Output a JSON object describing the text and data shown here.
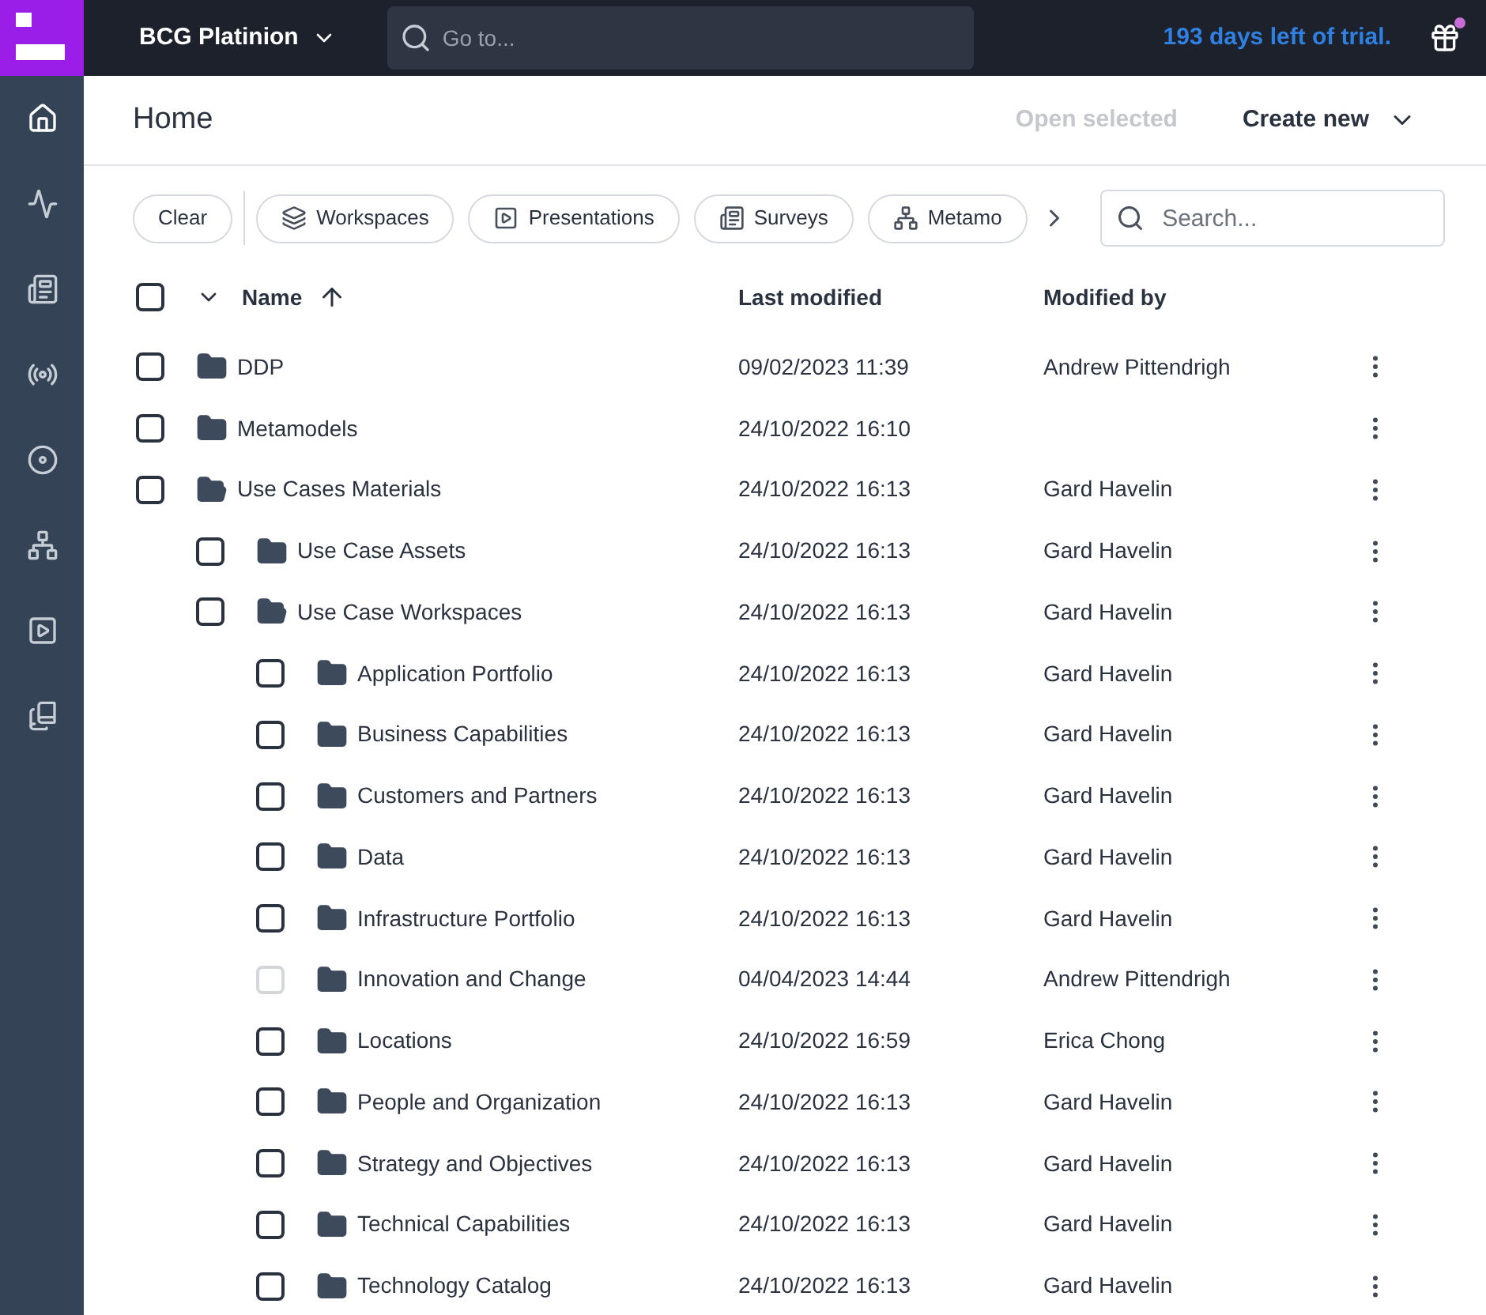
{
  "topbar": {
    "org": "BCG Platinion",
    "search_placeholder": "Go to...",
    "trial": "193 days left of trial.",
    "gift_notification": true
  },
  "sidebar": {
    "items": [
      {
        "selected": true
      },
      {
        "selected": false
      },
      {
        "selected": false
      },
      {
        "selected": false
      },
      {
        "selected": false
      },
      {
        "selected": false
      },
      {
        "selected": false
      },
      {
        "selected": false
      }
    ]
  },
  "header": {
    "title": "Home",
    "open_selected": {
      "label": "Open selected",
      "disabled": true
    },
    "create_new": "Create new"
  },
  "filters": {
    "clear": "Clear",
    "chips": [
      {
        "label": "Workspaces"
      },
      {
        "label": "Presentations"
      },
      {
        "label": "Surveys"
      },
      {
        "label": "Metamo"
      }
    ],
    "search_placeholder": "Search..."
  },
  "table": {
    "select_all": {
      "checked": false
    },
    "columns": [
      "Name",
      "Last modified",
      "Modified by"
    ],
    "rows": [
      {
        "name": "DDP",
        "modified": "09/02/2023 11:39",
        "by": "Andrew Pittendrigh",
        "expanded": false,
        "disabled": false
      },
      {
        "name": "Metamodels",
        "modified": "24/10/2022 16:10",
        "expanded": false,
        "disabled": false
      },
      {
        "name": "Use Cases Materials",
        "modified": "24/10/2022 16:13",
        "by": "Gard Havelin",
        "expanded": true,
        "disabled": false,
        "children": [
          {
            "name": "Use Case Assets",
            "modified": "24/10/2022 16:13",
            "by": "Gard Havelin",
            "expanded": false,
            "disabled": false
          },
          {
            "name": "Use Case Workspaces",
            "modified": "24/10/2022 16:13",
            "by": "Gard Havelin",
            "expanded": true,
            "disabled": false,
            "children": [
              {
                "name": "Application Portfolio",
                "modified": "24/10/2022 16:13",
                "by": "Gard Havelin",
                "expanded": false,
                "disabled": false
              },
              {
                "name": "Business Capabilities",
                "modified": "24/10/2022 16:13",
                "by": "Gard Havelin",
                "expanded": false,
                "disabled": false
              },
              {
                "name": "Customers and Partners",
                "modified": "24/10/2022 16:13",
                "by": "Gard Havelin",
                "expanded": false,
                "disabled": false
              },
              {
                "name": "Data",
                "modified": "24/10/2022 16:13",
                "by": "Gard Havelin",
                "expanded": false,
                "disabled": false
              },
              {
                "name": "Infrastructure Portfolio",
                "modified": "24/10/2022 16:13",
                "by": "Gard Havelin",
                "expanded": false,
                "disabled": false
              },
              {
                "name": "Innovation and Change",
                "modified": "04/04/2023 14:44",
                "by": "Andrew Pittendrigh",
                "expanded": false,
                "disabled": true
              },
              {
                "name": "Locations",
                "modified": "24/10/2022 16:59",
                "by": "Erica Chong",
                "expanded": false,
                "disabled": false
              },
              {
                "name": "People and Organization",
                "modified": "24/10/2022 16:13",
                "by": "Gard Havelin",
                "expanded": false,
                "disabled": false
              },
              {
                "name": "Strategy and Objectives",
                "modified": "24/10/2022 16:13",
                "by": "Gard Havelin",
                "expanded": false,
                "disabled": false
              },
              {
                "name": "Technical Capabilities",
                "modified": "24/10/2022 16:13",
                "by": "Gard Havelin",
                "expanded": false,
                "disabled": false
              },
              {
                "name": "Technology Catalog",
                "modified": "24/10/2022 16:13",
                "by": "Gard Havelin",
                "expanded": false,
                "disabled": false
              }
            ]
          }
        ]
      }
    ]
  }
}
